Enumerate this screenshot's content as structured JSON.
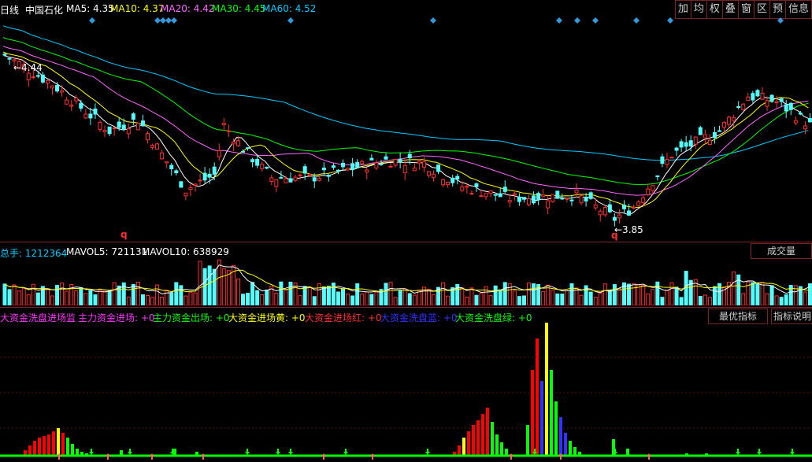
{
  "header": {
    "period": "日线",
    "stock_name": "中国石化",
    "ma": [
      {
        "label": "MA5: 4.35",
        "color": "#ffffff"
      },
      {
        "label": "MA10: 4.37",
        "color": "#ffff00"
      },
      {
        "label": "MA20: 4.42",
        "color": "#ff66ff"
      },
      {
        "label": "MA30: 4.45",
        "color": "#00ff00"
      },
      {
        "label": "MA60: 4.52",
        "color": "#00ccff"
      }
    ]
  },
  "toolbar": {
    "buttons": [
      "加",
      "均",
      "权",
      "叠",
      "窗",
      "区",
      "预",
      "信息"
    ]
  },
  "price_chart": {
    "high_label": "4.44",
    "low_label": "3.85",
    "marker_q": "q",
    "colors": {
      "up": "#ff3030",
      "down": "#54ffff",
      "ma5": "#ffffff",
      "ma10": "#ffff00",
      "ma20": "#ff66ff",
      "ma30": "#00ff00",
      "ma60": "#00ccff"
    }
  },
  "volume_panel": {
    "labels": [
      {
        "label": "总手: 1212364",
        "color": "#00ccff"
      },
      {
        "label": "MAVOL5: 721131",
        "color": "#ffffff"
      },
      {
        "label": "MAVOL10: 638929",
        "color": "#ffffff"
      }
    ],
    "button": "成交量"
  },
  "indicator_panel": {
    "labels": [
      {
        "label": "大资金洗盘进场监",
        "color": "#ff33ff"
      },
      {
        "label": "主力资金进场: +0",
        "color": "#ff33ff"
      },
      {
        "label": "主力资金出场: +0",
        "color": "#00ff00"
      },
      {
        "label": "大资金进场黄: +0",
        "color": "#ffff00"
      },
      {
        "label": "大资金进场红: +0",
        "color": "#ff3030"
      },
      {
        "label": "大资金洗盘蓝: +0",
        "color": "#3333ff"
      },
      {
        "label": "大资金洗盘绿: +0",
        "color": "#00ff00"
      }
    ],
    "buttons": [
      "最优指标",
      "指标说明"
    ]
  }
}
